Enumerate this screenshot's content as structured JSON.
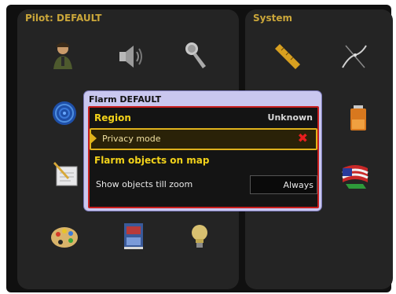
{
  "pilot_panel": {
    "title": "Pilot: DEFAULT"
  },
  "system_panel": {
    "title": "System"
  },
  "icons": [
    "pilot-avatar-icon",
    "speaker-icon",
    "microphone-icon",
    "globe-icon",
    "notepad-icon",
    "palette-icon",
    "book-icon",
    "lightbulb-icon",
    "ruler-icon",
    "route-icon",
    "battery-icon",
    "flag-icon"
  ],
  "dialog": {
    "title": "Flarm DEFAULT",
    "rows": [
      {
        "label": "Region",
        "value": "Unknown"
      },
      {
        "label": "Privacy mode",
        "value": "✖"
      },
      {
        "label": "Flarm objects on map"
      },
      {
        "label": "Show objects till zoom",
        "value": "Always"
      }
    ]
  },
  "colors": {
    "accent": "#e0b21c",
    "title": "#caa63a",
    "border_red": "#c81e1e",
    "dialog_bg": "#c9c7ef"
  }
}
